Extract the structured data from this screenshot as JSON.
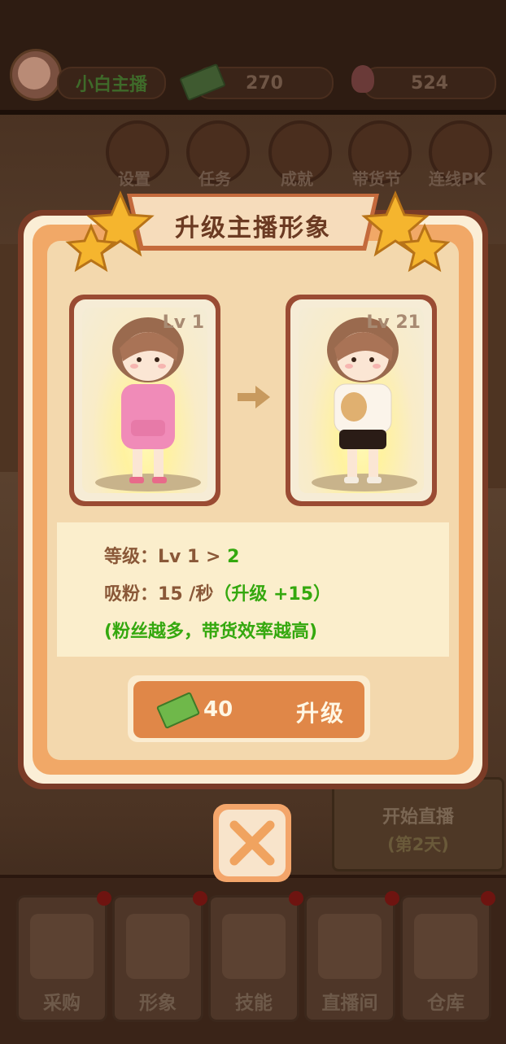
{
  "header": {
    "player_name": "小白主播",
    "cash": "270",
    "fans": "524"
  },
  "nav": [
    {
      "label": "设置",
      "icon": "gear-icon"
    },
    {
      "label": "任务",
      "icon": "task-icon"
    },
    {
      "label": "成就",
      "icon": "trophy-icon"
    },
    {
      "label": "带货节",
      "icon": "sale-bag-icon"
    },
    {
      "label": "连线PK",
      "icon": "pk-icon"
    }
  ],
  "modal": {
    "title": "升级主播形象",
    "current_level": "Lv 1",
    "next_level": "Lv 21",
    "level_line": {
      "label": "等级：",
      "value": "Lv 1 > ",
      "next": "2"
    },
    "fans_line": {
      "label": "吸粉：",
      "value": "15 /秒",
      "bonus": "（升级 +15）"
    },
    "hint": "(粉丝越多，带货效率越高)",
    "upgrade_cost": "40",
    "upgrade_label": "升级"
  },
  "start_live": {
    "label": "开始直播",
    "day": "(第2天)"
  },
  "bottom_tabs": [
    {
      "label": "采购",
      "icon": "shop-icon"
    },
    {
      "label": "形象",
      "icon": "avatar-icon"
    },
    {
      "label": "技能",
      "icon": "microphone-icon"
    },
    {
      "label": "直播间",
      "icon": "live-room-icon"
    },
    {
      "label": "仓库",
      "icon": "warehouse-icon"
    }
  ],
  "colors": {
    "accent": "#e08748",
    "green": "#34a80e",
    "frame": "#7a3b26"
  }
}
